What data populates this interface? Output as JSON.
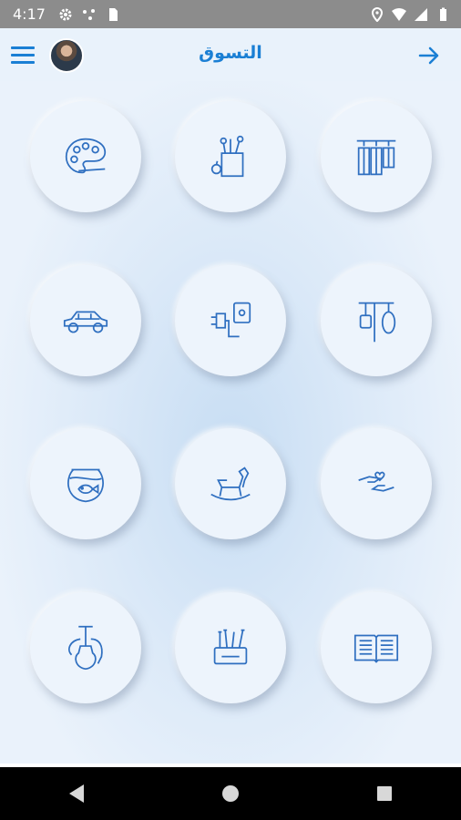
{
  "status_bar": {
    "time": "4:17",
    "left_icons": [
      "gear-icon",
      "dots-icon",
      "sim-icon"
    ],
    "right_icons": [
      "location-icon",
      "wifi-icon",
      "signal-icon",
      "battery-icon"
    ]
  },
  "app_bar": {
    "title": "التسوق",
    "menu_icon": "hamburger-menu-icon",
    "back_icon": "arrow-right-icon"
  },
  "colors": {
    "accent": "#1a7fd4",
    "icon_stroke": "#2f6fc0",
    "tile_bg": "#edf4fc",
    "status_bar": "#8c8c8c"
  },
  "categories": [
    {
      "icon": "art-palette-icon"
    },
    {
      "icon": "grocery-bag-icon"
    },
    {
      "icon": "clothes-rack-icon"
    },
    {
      "icon": "car-icon"
    },
    {
      "icon": "electric-plug-icon"
    },
    {
      "icon": "kitchen-utensils-icon"
    },
    {
      "icon": "fish-bowl-icon"
    },
    {
      "icon": "rocking-horse-icon"
    },
    {
      "icon": "charity-hands-icon"
    },
    {
      "icon": "hookah-icon"
    },
    {
      "icon": "tools-box-icon"
    },
    {
      "icon": "open-book-icon"
    }
  ],
  "nav_bar": {
    "buttons": [
      "back-triangle-icon",
      "home-circle-icon",
      "recents-square-icon"
    ]
  }
}
